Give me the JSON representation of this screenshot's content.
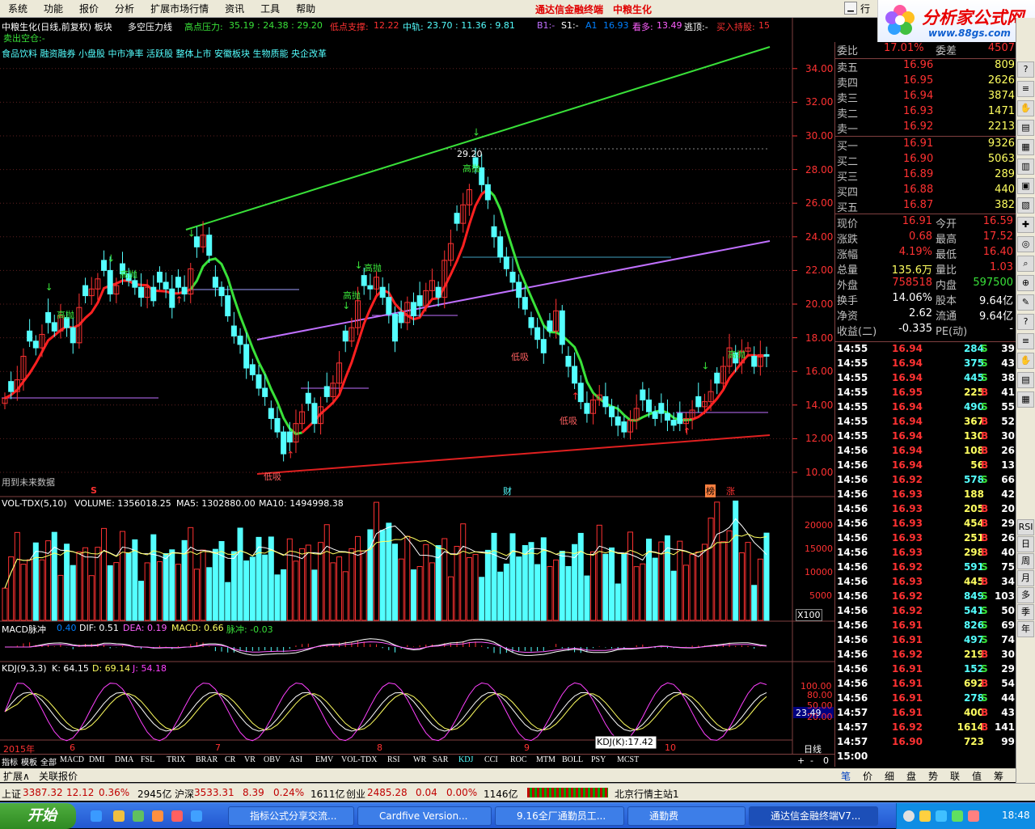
{
  "menu": {
    "items": [
      "系统",
      "功能",
      "报价",
      "分析",
      "扩展市场行情",
      "资讯",
      "工具",
      "帮助"
    ],
    "center_title": "通达信金融终端",
    "stock_name": "中粮生化",
    "right_label": "行"
  },
  "logo": {
    "title": "分析家公式网",
    "url": "www.88gs.com"
  },
  "main_chart": {
    "header_left": "中粮生化(日线,前复权) 板块",
    "indicator_name": "多空压力线",
    "high_label": "高点压力:",
    "high_values": "35.19 : 24.38 : 29.20",
    "low_label": "低点支撑:",
    "low_value": "12.22",
    "mid_label": "中轨:",
    "mid_values": "23.70 : 11.36 : 9.81",
    "b1": "B1:-",
    "s1": "S1:-",
    "a1": "A1",
    "a1_value": "16.93",
    "kanduo_label": "看多:",
    "kanduo_value": "13.49",
    "taoding": "逃顶:-",
    "buy_hold": "买入持股:",
    "buy_hold_value": "15",
    "sell_line": "卖出空仓:-",
    "concepts": "食品饮料 融资融券 小盘股 中市净率 活跃股 整体上市 安徽板块 生物质能 央企改革",
    "future_note": "用到未来数据",
    "peak_label": "29.20",
    "high_throw": "高抛",
    "low_buy": "低吸",
    "event_s": "S",
    "event_cai": "财",
    "event_bang": "榜",
    "event_zhang": "涨"
  },
  "price_axis": [
    "34.00",
    "32.00",
    "30.00",
    "28.00",
    "26.00",
    "24.00",
    "22.00",
    "20.00",
    "18.00",
    "16.00",
    "14.00",
    "12.00",
    "10.00"
  ],
  "volume_panel": {
    "name": "VOL-TDX(5,10)",
    "volume": "VOLUME: 1356018.25",
    "ma5": "MA5: 1302880.00",
    "ma10": "MA10: 1494998.38",
    "axis": [
      "20000",
      "15000",
      "10000",
      "5000"
    ],
    "unit": "X100"
  },
  "macd_panel": {
    "name": "MACD脉冲",
    "value": "0.40",
    "dif": "DIF: 0.51",
    "dea": "DEA: 0.19",
    "macd": "MACD: 0.66",
    "pulse": "脉冲: -0.03"
  },
  "kdj_panel": {
    "name": "KDJ(9,3,3)",
    "k": "K: 64.15",
    "d": "D: 69.14",
    "j": "J: 54.18",
    "axis": [
      "100.00",
      "80.00",
      "50.00",
      "20.00"
    ],
    "cursor_value": "23.49",
    "tooltip": "KDJ(K):17.42"
  },
  "time_axis": [
    "2015年",
    "6",
    "7",
    "8",
    "9",
    "10"
  ],
  "daily_label": "日线",
  "indicator_tabs": [
    "指标",
    "模板",
    "全部",
    "MACD",
    "DMI",
    "DMA",
    "FSL",
    "TRIX",
    "BRAR",
    "CR",
    "VR",
    "OBV",
    "ASI",
    "EMV",
    "VOL-TDX",
    "RSI",
    "WR",
    "SAR",
    "KDJ",
    "CCI",
    "ROC",
    "MTM",
    "BOLL",
    "PSY",
    "MCST"
  ],
  "sub_tabs": [
    "扩展∧",
    "关联报价"
  ],
  "tab_controls": [
    "+",
    "-",
    "0"
  ],
  "quote": {
    "webi_label": "委比",
    "webi_value": "17.01%",
    "wecha_label": "委差",
    "wecha_value": "4507",
    "sells": [
      {
        "label": "卖五",
        "price": "16.96",
        "vol": "809"
      },
      {
        "label": "卖四",
        "price": "16.95",
        "vol": "2626"
      },
      {
        "label": "卖三",
        "price": "16.94",
        "vol": "3874"
      },
      {
        "label": "卖二",
        "price": "16.93",
        "vol": "1471"
      },
      {
        "label": "卖一",
        "price": "16.92",
        "vol": "2213"
      }
    ],
    "buys": [
      {
        "label": "买一",
        "price": "16.91",
        "vol": "9326"
      },
      {
        "label": "买二",
        "price": "16.90",
        "vol": "5063"
      },
      {
        "label": "买三",
        "price": "16.89",
        "vol": "289"
      },
      {
        "label": "买四",
        "price": "16.88",
        "vol": "440"
      },
      {
        "label": "买五",
        "price": "16.87",
        "vol": "382"
      }
    ],
    "stats": [
      {
        "l1": "现价",
        "v1": "16.91",
        "l2": "今开",
        "v2": "16.59"
      },
      {
        "l1": "涨跌",
        "v1": "0.68",
        "l2": "最高",
        "v2": "17.52"
      },
      {
        "l1": "涨幅",
        "v1": "4.19%",
        "l2": "最低",
        "v2": "16.40"
      },
      {
        "l1": "总量",
        "v1": "135.6万",
        "l2": "量比",
        "v2": "1.03"
      },
      {
        "l1": "外盘",
        "v1": "758518",
        "l2": "内盘",
        "v2": "597500"
      },
      {
        "l1": "换手",
        "v1": "14.06%",
        "l2": "股本",
        "v2": "9.64亿"
      },
      {
        "l1": "净资",
        "v1": "2.62",
        "l2": "流通",
        "v2": "9.64亿"
      },
      {
        "l1": "收益(二)",
        "v1": "-0.335",
        "l2": "PE(动)",
        "v2": "-"
      }
    ],
    "ticks": [
      [
        "14:55",
        "16.94",
        "284",
        "S",
        "39"
      ],
      [
        "14:55",
        "16.94",
        "375",
        "S",
        "43"
      ],
      [
        "14:55",
        "16.94",
        "445",
        "S",
        "38"
      ],
      [
        "14:55",
        "16.95",
        "225",
        "B",
        "41"
      ],
      [
        "14:55",
        "16.94",
        "490",
        "S",
        "55"
      ],
      [
        "14:55",
        "16.94",
        "367",
        "B",
        "52"
      ],
      [
        "14:55",
        "16.94",
        "130",
        "B",
        "30"
      ],
      [
        "14:56",
        "16.94",
        "108",
        "B",
        "26"
      ],
      [
        "14:56",
        "16.94",
        "56",
        "B",
        "13"
      ],
      [
        "14:56",
        "16.92",
        "578",
        "S",
        "66"
      ],
      [
        "14:56",
        "16.93",
        "188",
        "",
        "42"
      ],
      [
        "14:56",
        "16.93",
        "205",
        "B",
        "20"
      ],
      [
        "14:56",
        "16.93",
        "454",
        "B",
        "29"
      ],
      [
        "14:56",
        "16.93",
        "251",
        "B",
        "26"
      ],
      [
        "14:56",
        "16.93",
        "298",
        "B",
        "40"
      ],
      [
        "14:56",
        "16.92",
        "591",
        "S",
        "75"
      ],
      [
        "14:56",
        "16.93",
        "445",
        "B",
        "34"
      ],
      [
        "14:56",
        "16.92",
        "849",
        "S",
        "103"
      ],
      [
        "14:56",
        "16.92",
        "541",
        "S",
        "50"
      ],
      [
        "14:56",
        "16.91",
        "826",
        "S",
        "69"
      ],
      [
        "14:56",
        "16.91",
        "497",
        "S",
        "74"
      ],
      [
        "14:56",
        "16.92",
        "219",
        "B",
        "30"
      ],
      [
        "14:56",
        "16.91",
        "152",
        "S",
        "29"
      ],
      [
        "14:56",
        "16.91",
        "692",
        "B",
        "54"
      ],
      [
        "14:56",
        "16.91",
        "278",
        "S",
        "44"
      ],
      [
        "14:57",
        "16.91",
        "400",
        "B",
        "43"
      ],
      [
        "14:57",
        "16.92",
        "1614",
        "B",
        "141"
      ],
      [
        "14:57",
        "16.90",
        "723",
        "",
        "99"
      ],
      [
        "15:00",
        "",
        "",
        "",
        ""
      ]
    ],
    "bottom_tabs": [
      "笔",
      "价",
      "细",
      "盘",
      "势",
      "联",
      "值",
      "筹"
    ]
  },
  "sidebar_labels": [
    "RSI",
    "日",
    "周",
    "月",
    "多",
    "季",
    "年"
  ],
  "statusbar": {
    "sh_label": "上证",
    "sh_val": "3387.32",
    "sh_chg": "12.12",
    "sh_pct": "0.36%",
    "sh_amt": "2945亿",
    "hs_label": "沪深",
    "hs_val": "3533.31",
    "hs_chg": "8.39",
    "hs_pct": "0.24%",
    "hs_amt": "1611亿",
    "cy_label": "创业",
    "cy_val": "2485.28",
    "cy_chg": "0.04",
    "cy_pct": "0.00%",
    "cy_amt": "1146亿",
    "server": "北京行情主站1"
  },
  "taskbar": {
    "start": "开始",
    "items": [
      "指标公式分享交流...",
      "Cardfive Version...",
      "9.16全厂通勤员工...",
      "通勤费",
      "通达信金融终端V7..."
    ],
    "time": "18:48"
  },
  "colors": {
    "up": "#ff3232",
    "down": "#54ffff",
    "green_line": "#39e139",
    "purple_line": "#c070ff"
  }
}
